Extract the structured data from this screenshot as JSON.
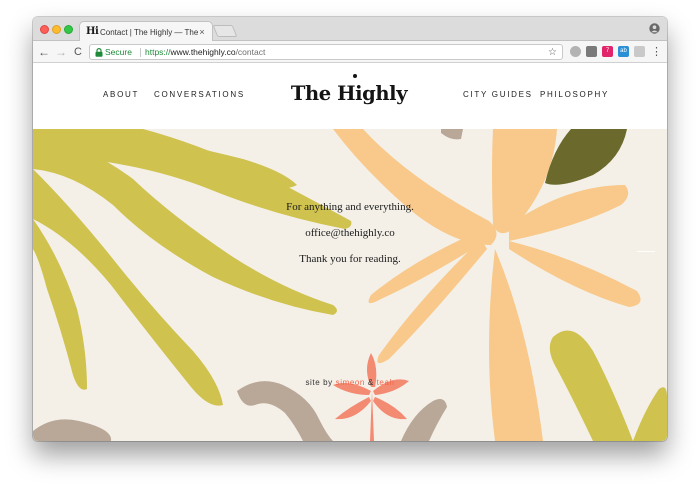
{
  "browser": {
    "tab": {
      "favicon_text": "Hi",
      "title": "Contact | The Highly — The Hi",
      "close_glyph": "×"
    },
    "toolbar": {
      "back_glyph": "←",
      "forward_glyph": "→",
      "reload_glyph": "C",
      "secure_label": "Secure",
      "url_scheme": "https://",
      "url_host": "www.thehighly.co",
      "url_path": "/contact",
      "star_glyph": "☆",
      "menu_glyph": "⋮",
      "extensions": [
        {
          "icon": "cloud-extension-icon",
          "text": ""
        },
        {
          "icon": "pocket-extension-icon",
          "text": ""
        },
        {
          "icon": "pinterest-extension-icon",
          "text": "7"
        },
        {
          "icon": "translate-extension-icon",
          "text": "ab"
        },
        {
          "icon": "clipboard-extension-icon",
          "text": ""
        }
      ]
    },
    "window_controls": [
      "close",
      "minimize",
      "zoom"
    ],
    "profile_icon": "person-icon"
  },
  "site": {
    "logo": "The Highly",
    "nav_left": [
      "ABOUT",
      "CONVERSATIONS"
    ],
    "nav_right": [
      "CITY GUIDES",
      "PHILOSOPHY"
    ],
    "hero": {
      "line1": "For anything and everything.",
      "line2": "office@thehighly.co",
      "line3": "Thank you for reading."
    },
    "credit": {
      "prefix": "site by",
      "name1": "simeon",
      "amp": "&",
      "name2": "teah"
    }
  },
  "colors": {
    "hero_background": "#f4f0e8",
    "olive_leaf": "#cfc24e",
    "dark_olive": "#6b6a2c",
    "peach_leaf": "#f8c98a",
    "taupe": "#b9a898",
    "coral": "#f38a72",
    "credit_link": "#f0664d",
    "secure_green": "#1e8a3a"
  }
}
